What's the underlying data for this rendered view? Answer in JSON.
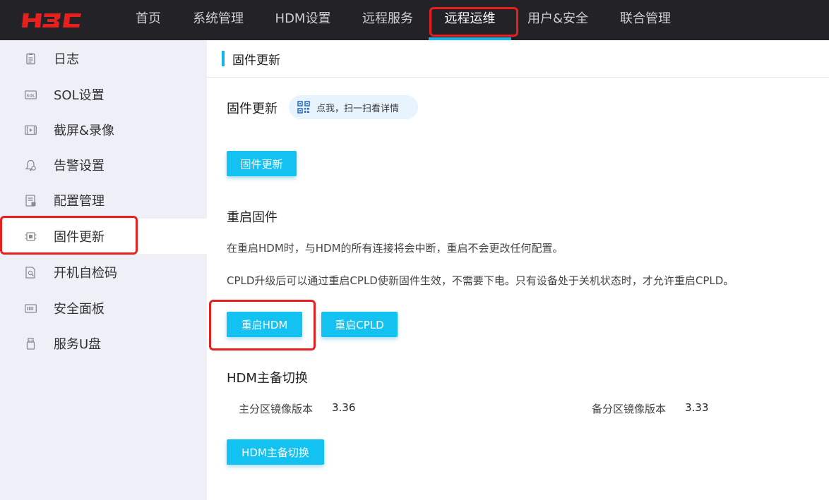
{
  "brand": {
    "logo_text": "H3C",
    "logo_color": "#e8201d"
  },
  "topnav": {
    "items": [
      {
        "label": "首页"
      },
      {
        "label": "系统管理"
      },
      {
        "label": "HDM设置"
      },
      {
        "label": "远程服务"
      },
      {
        "label": "远程运维",
        "active": true
      },
      {
        "label": "用户&安全"
      },
      {
        "label": "联合管理"
      }
    ]
  },
  "sidebar": {
    "items": [
      {
        "label": "日志",
        "icon": "log-icon"
      },
      {
        "label": "SOL设置",
        "icon": "sol-icon"
      },
      {
        "label": "截屏&录像",
        "icon": "video-icon"
      },
      {
        "label": "告警设置",
        "icon": "alarm-bell-icon"
      },
      {
        "label": "配置管理",
        "icon": "config-icon"
      },
      {
        "label": "固件更新",
        "icon": "chip-icon",
        "active": true
      },
      {
        "label": "开机自检码",
        "icon": "post-code-icon"
      },
      {
        "label": "安全面板",
        "icon": "panel-icon"
      },
      {
        "label": "服务U盘",
        "icon": "usb-icon"
      }
    ]
  },
  "page": {
    "title": "固件更新",
    "firmware": {
      "title": "固件更新",
      "qr_hint": "点我，扫一扫看详情",
      "button": "固件更新"
    },
    "restart": {
      "title": "重启固件",
      "desc1": "在重启HDM时，与HDM的所有连接将会中断，重启不会更改任何配置。",
      "desc2": "CPLD升级后可以通过重启CPLD使新固件生效，不需要下电。只有设备处于关机状态时，才允许重启CPLD。",
      "btn_hdm": "重启HDM",
      "btn_cpld": "重启CPLD"
    },
    "switch": {
      "title": "HDM主备切换",
      "primary_label": "主分区镜像版本",
      "primary_value": "3.36",
      "backup_label": "备分区镜像版本",
      "backup_value": "3.33",
      "button": "HDM主备切换"
    }
  },
  "colors": {
    "accent": "#14c2f2",
    "highlight": "#e8201d",
    "topbar": "#232327",
    "sidebar": "#eeeff7"
  }
}
